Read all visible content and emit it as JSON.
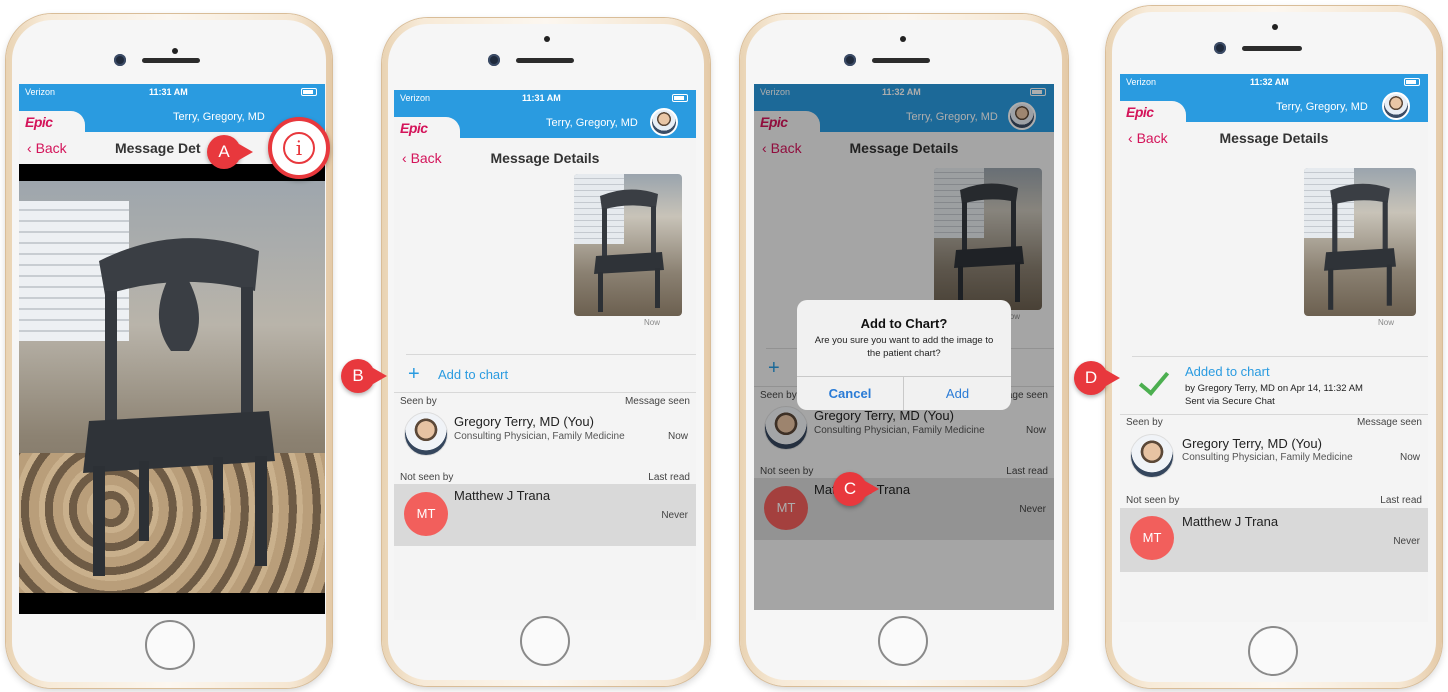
{
  "common": {
    "carrier": "Verizon",
    "user_name": "Terry, Gregory, MD",
    "logo": "Epic",
    "back_label": "Back",
    "title": "Message Details",
    "time_a": "11:31 AM",
    "time_b": "11:31 AM",
    "time_c": "11:32 AM",
    "time_d": "11:32 AM",
    "title_truncated": "Message Det",
    "now_label": "Now",
    "add_to_chart": "Add to chart",
    "seen_by": "Seen by",
    "message_seen": "Message seen",
    "not_seen_by": "Not seen by",
    "last_read": "Last read",
    "seen_user": "Gregory Terry, MD (You)",
    "seen_user_role": "Consulting Physician, Family Medicine",
    "seen_time": "Now",
    "unseen_user": "Matthew J Trana",
    "unseen_initials": "MT",
    "unseen_time": "Never"
  },
  "dialog": {
    "title": "Add to Chart?",
    "message": "Are you sure you want to add the image to the patient chart?",
    "cancel": "Cancel",
    "add": "Add"
  },
  "added": {
    "label": "Added to chart",
    "by": "by Gregory Terry, MD on Apr 14, 11:32 AM",
    "via": "Sent via Secure Chat"
  },
  "callouts": {
    "a": "A",
    "b": "B",
    "c": "C",
    "d": "D"
  },
  "colors": {
    "accent": "#2a9be0",
    "brand": "#d4145a",
    "callout": "#e8383d",
    "check": "#4caf50"
  }
}
